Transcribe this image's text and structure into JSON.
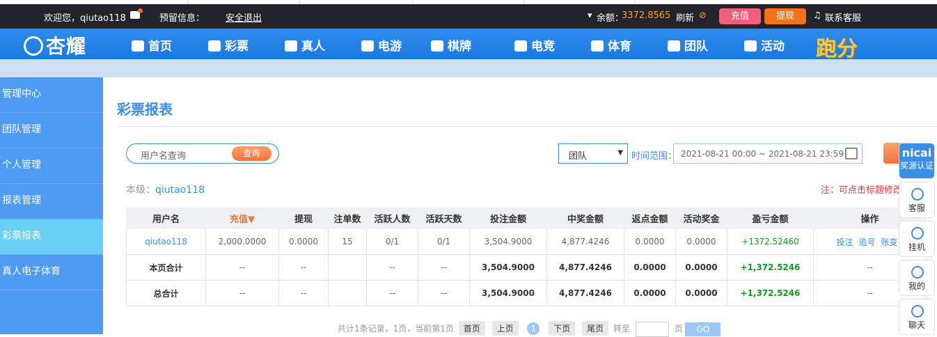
{
  "topbar": {
    "welcome": "欢迎您，qiutao118",
    "notice_label": "预留信息：",
    "logout": "安全退出",
    "balance_label": "余额：",
    "balance": "3372.8565",
    "refresh": "刷新",
    "recharge": "充值",
    "withdraw": "提现",
    "support": "联系客服"
  },
  "nav": {
    "logo": "杏耀",
    "items": [
      "首页",
      "彩票",
      "真人",
      "电游",
      "棋牌",
      "电竞",
      "体育",
      "团队",
      "活动"
    ],
    "paofen": "跑分"
  },
  "sidebar": {
    "items": [
      "管理中心",
      "团队管理",
      "个人管理",
      "报表管理",
      "彩票报表",
      "真人电子体育"
    ]
  },
  "main": {
    "title": "彩票报表",
    "search_placeholder": "用户名查询",
    "search_button": "查询",
    "select_value": "团队",
    "time_label": "时间范围：",
    "date_range": "2021-08-21 00:00 ~ 2021-08-21 23:59",
    "level_label": "本级：",
    "level_user": "qiutao118",
    "note": "注：可点击标题修改"
  },
  "table": {
    "headers": [
      "用户名",
      "充值▼",
      "提现",
      "注单数",
      "活跃人数",
      "活跃天数",
      "投注金额",
      "中奖金额",
      "返点金额",
      "活动奖金",
      "盈亏金额",
      "操作"
    ],
    "row": [
      "qiutao118",
      "2,000.0000",
      "0.0000",
      "15",
      "0/1",
      "0/1",
      "3,504.9000",
      "4,877.4246",
      "0.0000",
      "0.0000",
      "+1372.52460"
    ],
    "ops": [
      "投注",
      "追号",
      "账变"
    ],
    "page_total": [
      "本页合计",
      "--",
      "--",
      "",
      "--",
      "--",
      "3,504.9000",
      "4,877.4246",
      "0.0000",
      "0.0000",
      "+1,372.5246",
      "--"
    ],
    "grand_total": [
      "总合计",
      "--",
      "--",
      "",
      "--",
      "--",
      "3,504.9000",
      "4,877.4246",
      "0.0000",
      "0.0000",
      "+1,372.5246",
      "--"
    ]
  },
  "pager": {
    "info": "共计1条记录，1页，当前第1页",
    "first": "首页",
    "prev": "上页",
    "current": "1",
    "next": "下页",
    "last": "尾页",
    "goto": "转至",
    "page_unit": "页",
    "go": "GO"
  },
  "floatbar": {
    "nicai": "nicai",
    "nicai_sub": "奖源认证",
    "items": [
      "客服",
      "挂机",
      "我的",
      "聊天"
    ]
  }
}
